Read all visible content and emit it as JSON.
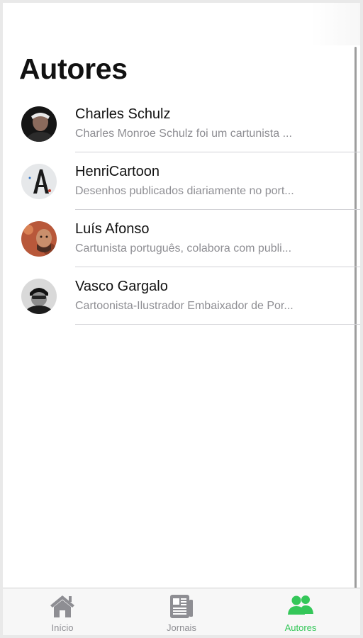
{
  "page": {
    "title": "Autores"
  },
  "authors": [
    {
      "name": "Charles Schulz",
      "description": "Charles Monroe Schulz foi um cartunista ..."
    },
    {
      "name": "HenriCartoon",
      "description": "Desenhos publicados diariamente no port..."
    },
    {
      "name": "Luís Afonso",
      "description": "Cartunista português, colabora com publi..."
    },
    {
      "name": "Vasco Gargalo",
      "description": "Cartoonista-Ilustrador Embaixador de Por..."
    }
  ],
  "tabs": [
    {
      "label": "Início",
      "icon": "house-icon",
      "active": false
    },
    {
      "label": "Jornais",
      "icon": "newspaper-icon",
      "active": false
    },
    {
      "label": "Autores",
      "icon": "people-icon",
      "active": true
    }
  ],
  "colors": {
    "accent": "#34c759",
    "inactive_tab": "#8e8e93",
    "secondary_text": "#8e8e93",
    "divider": "#d2d2d6"
  }
}
